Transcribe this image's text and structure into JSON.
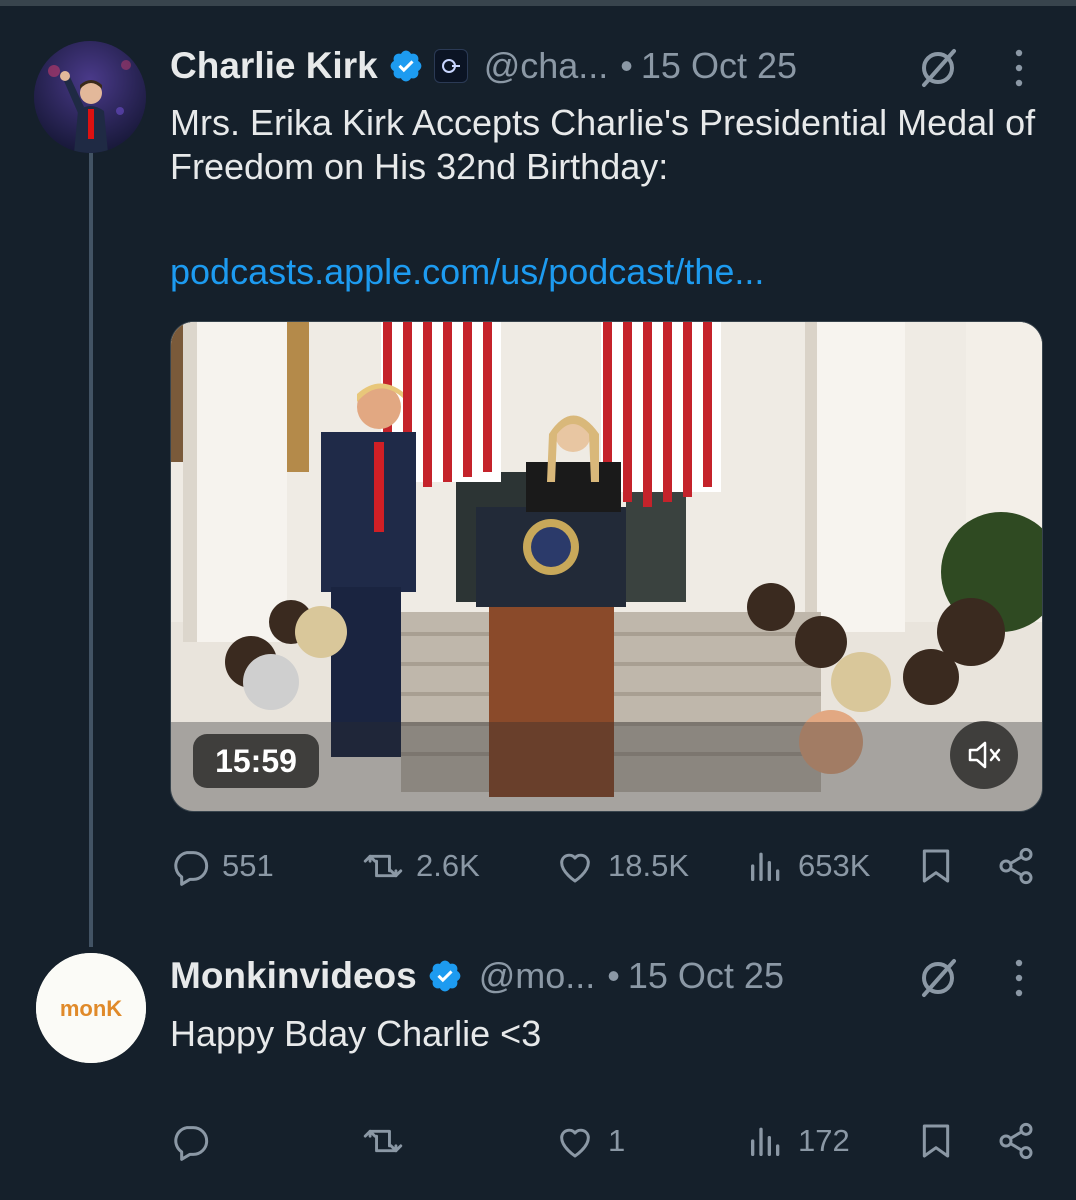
{
  "tweets": [
    {
      "author": "Charlie Kirk",
      "handle": "@cha...",
      "date": "15 Oct 25",
      "text": "Mrs. Erika Kirk Accepts Charlie's Presidential Medal of Freedom on His 32nd Birthday:",
      "link": "podcasts.apple.com/us/podcast/the...",
      "media": {
        "type": "video",
        "duration": "15:59",
        "muted": true
      },
      "stats": {
        "replies": "551",
        "reposts": "2.6K",
        "likes": "18.5K",
        "views": "653K"
      }
    },
    {
      "author": "Monkinvideos",
      "handle": "@mo...",
      "date": "15 Oct 25",
      "avatar_text": "monK",
      "text": "Happy Bday Charlie <3",
      "stats": {
        "replies": "",
        "reposts": "",
        "likes": "1",
        "views": "172"
      }
    }
  ],
  "separator": "•",
  "icons": [
    "verified-badge",
    "affiliate-badge",
    "grok-icon",
    "more-icon",
    "reply-icon",
    "repost-icon",
    "like-icon",
    "views-icon",
    "bookmark-icon",
    "share-icon",
    "mute-icon"
  ],
  "colors": {
    "background": "#15202b",
    "text": "#e7e9ea",
    "muted": "#8b98a5",
    "link": "#1d9bf0",
    "verified": "#1d9bf0"
  }
}
